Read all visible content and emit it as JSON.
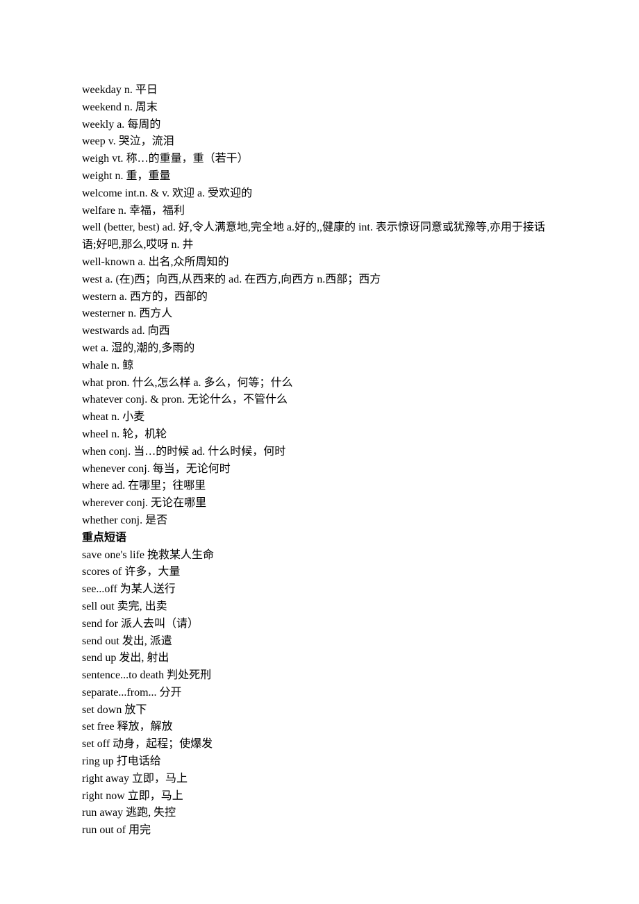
{
  "vocab": [
    {
      "word": "weekday",
      "pos": "n.",
      "def": "平日"
    },
    {
      "word": "weekend",
      "pos": "n.",
      "def": "周末"
    },
    {
      "word": "weekly",
      "pos": "a.",
      "def": "每周的"
    },
    {
      "word": "weep",
      "pos": "v.",
      "def": "哭泣，流泪"
    },
    {
      "word": "weigh",
      "pos": "vt.",
      "def": "称…的重量，重（若干）"
    },
    {
      "word": "weight",
      "pos": "n.",
      "def": "重，重量"
    },
    {
      "word": "welcome",
      "pos": "int.n. & v.",
      "def": "欢迎  a.  受欢迎的"
    },
    {
      "word": "welfare",
      "pos": "n.",
      "def": "幸福，福利"
    },
    {
      "word": "well",
      "pos": "(better, best) ad.",
      "def": "好,令人满意地,完全地  a.好的,,健康的 int.  表示惊讶同意或犹豫等,亦用于接话语;好吧,那么,哎呀  n.  井"
    },
    {
      "word": "well-known",
      "pos": "a.",
      "def": "出名,众所周知的"
    },
    {
      "word": "west",
      "pos": "a.",
      "def": "(在)西；向西,从西来的  ad.  在西方,向西方  n.西部；西方"
    },
    {
      "word": "western",
      "pos": "a.",
      "def": "西方的，西部的"
    },
    {
      "word": "westerner",
      "pos": "n.",
      "def": "西方人"
    },
    {
      "word": "westwards",
      "pos": "ad.",
      "def": "向西"
    },
    {
      "word": "wet",
      "pos": "a.",
      "def": "湿的,潮的,多雨的"
    },
    {
      "word": "whale",
      "pos": "n.",
      "def": "鲸"
    },
    {
      "word": "what",
      "pos": "pron.",
      "def": "什么,怎么样  a.  多么，何等；什么"
    },
    {
      "word": "whatever",
      "pos": "conj. & pron.",
      "def": "无论什么，不管什么"
    },
    {
      "word": "wheat",
      "pos": "n.",
      "def": "小麦"
    },
    {
      "word": "wheel",
      "pos": "n.",
      "def": "轮，机轮"
    },
    {
      "word": "when",
      "pos": "conj.",
      "def": "当…的时候  ad.  什么时候，何时"
    },
    {
      "word": "whenever",
      "pos": "conj.",
      "def": "每当，无论何时"
    },
    {
      "word": "where",
      "pos": "ad.",
      "def": "在哪里；往哪里"
    },
    {
      "word": "wherever",
      "pos": "conj.",
      "def": "无论在哪里"
    },
    {
      "word": "whether",
      "pos": "conj.",
      "def": "是否"
    }
  ],
  "phrases_heading": "重点短语",
  "phrases": [
    {
      "phrase": "save one's life",
      "def": "挽救某人生命"
    },
    {
      "phrase": "scores of",
      "def": "许多，大量"
    },
    {
      "phrase": "see...off",
      "def": "为某人送行"
    },
    {
      "phrase": "sell out",
      "def": "卖完,  出卖"
    },
    {
      "phrase": "send for",
      "def": "派人去叫（请）"
    },
    {
      "phrase": "send out",
      "def": "发出,  派遣"
    },
    {
      "phrase": "send up",
      "def": "发出,  射出"
    },
    {
      "phrase": "sentence...to death",
      "def": "判处死刑"
    },
    {
      "phrase": "separate...from...",
      "def": "分开"
    },
    {
      "phrase": "set down",
      "def": "放下"
    },
    {
      "phrase": "set free",
      "def": "释放，解放"
    },
    {
      "phrase": "set off",
      "def": "动身，起程；使爆发"
    },
    {
      "phrase": "ring up",
      "def": "打电话给"
    },
    {
      "phrase": "right away",
      "def": "立即，马上"
    },
    {
      "phrase": "right now",
      "def": "立即，马上"
    },
    {
      "phrase": "run away",
      "def": "逃跑,  失控"
    },
    {
      "phrase": "run out of",
      "def": "用完"
    }
  ]
}
